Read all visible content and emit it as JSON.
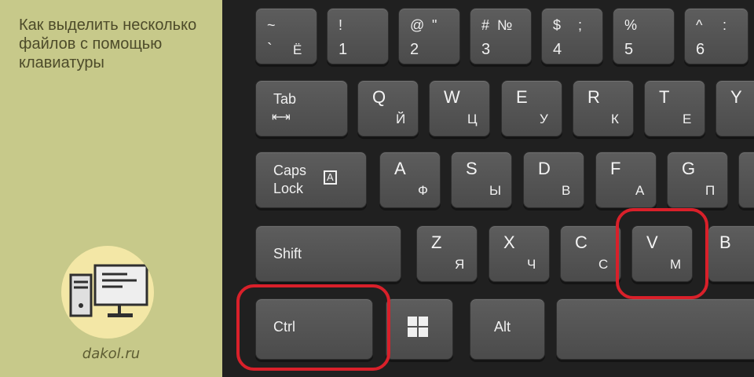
{
  "sidebar": {
    "title": "Как выделить несколько файлов с помощью клавиатуры",
    "site": "dakol.ru"
  },
  "keys": {
    "tilde": {
      "top": "~",
      "bottom": "`",
      "cyr": "Ё"
    },
    "k1": {
      "top": "!",
      "bottom": "1"
    },
    "k2": {
      "top": "@",
      "top2": "\"",
      "bottom": "2"
    },
    "k3": {
      "top": "#",
      "top2": "№",
      "bottom": "3"
    },
    "k4": {
      "top": "$",
      "top2": ";",
      "bottom": "4"
    },
    "k5": {
      "top": "%",
      "bottom": "5"
    },
    "k6": {
      "top": "^",
      "top2": ":",
      "bottom": "6"
    },
    "tab": {
      "label": "Tab",
      "symbol": "⇤⇥"
    },
    "q": {
      "lat": "Q",
      "cyr": "Й"
    },
    "w": {
      "lat": "W",
      "cyr": "Ц"
    },
    "e": {
      "lat": "E",
      "cyr": "У"
    },
    "r": {
      "lat": "R",
      "cyr": "К"
    },
    "t": {
      "lat": "T",
      "cyr": "Е"
    },
    "y": {
      "lat": "Y"
    },
    "caps": {
      "line1": "Caps",
      "line2": "Lock",
      "symbol": "A"
    },
    "a": {
      "lat": "A",
      "cyr": "Ф"
    },
    "s": {
      "lat": "S",
      "cyr": "Ы"
    },
    "d": {
      "lat": "D",
      "cyr": "В"
    },
    "f": {
      "lat": "F",
      "cyr": "А"
    },
    "g": {
      "lat": "G",
      "cyr": "П"
    },
    "shift": {
      "label": "Shift"
    },
    "z": {
      "lat": "Z",
      "cyr": "Я"
    },
    "x": {
      "lat": "X",
      "cyr": "Ч"
    },
    "c": {
      "lat": "C",
      "cyr": "С"
    },
    "v": {
      "lat": "V",
      "cyr": "М"
    },
    "b": {
      "lat": "B"
    },
    "ctrl": {
      "label": "Ctrl"
    },
    "alt": {
      "label": "Alt"
    }
  },
  "highlight_color": "#d9202a",
  "highlighted_keys": [
    "Ctrl",
    "V"
  ]
}
